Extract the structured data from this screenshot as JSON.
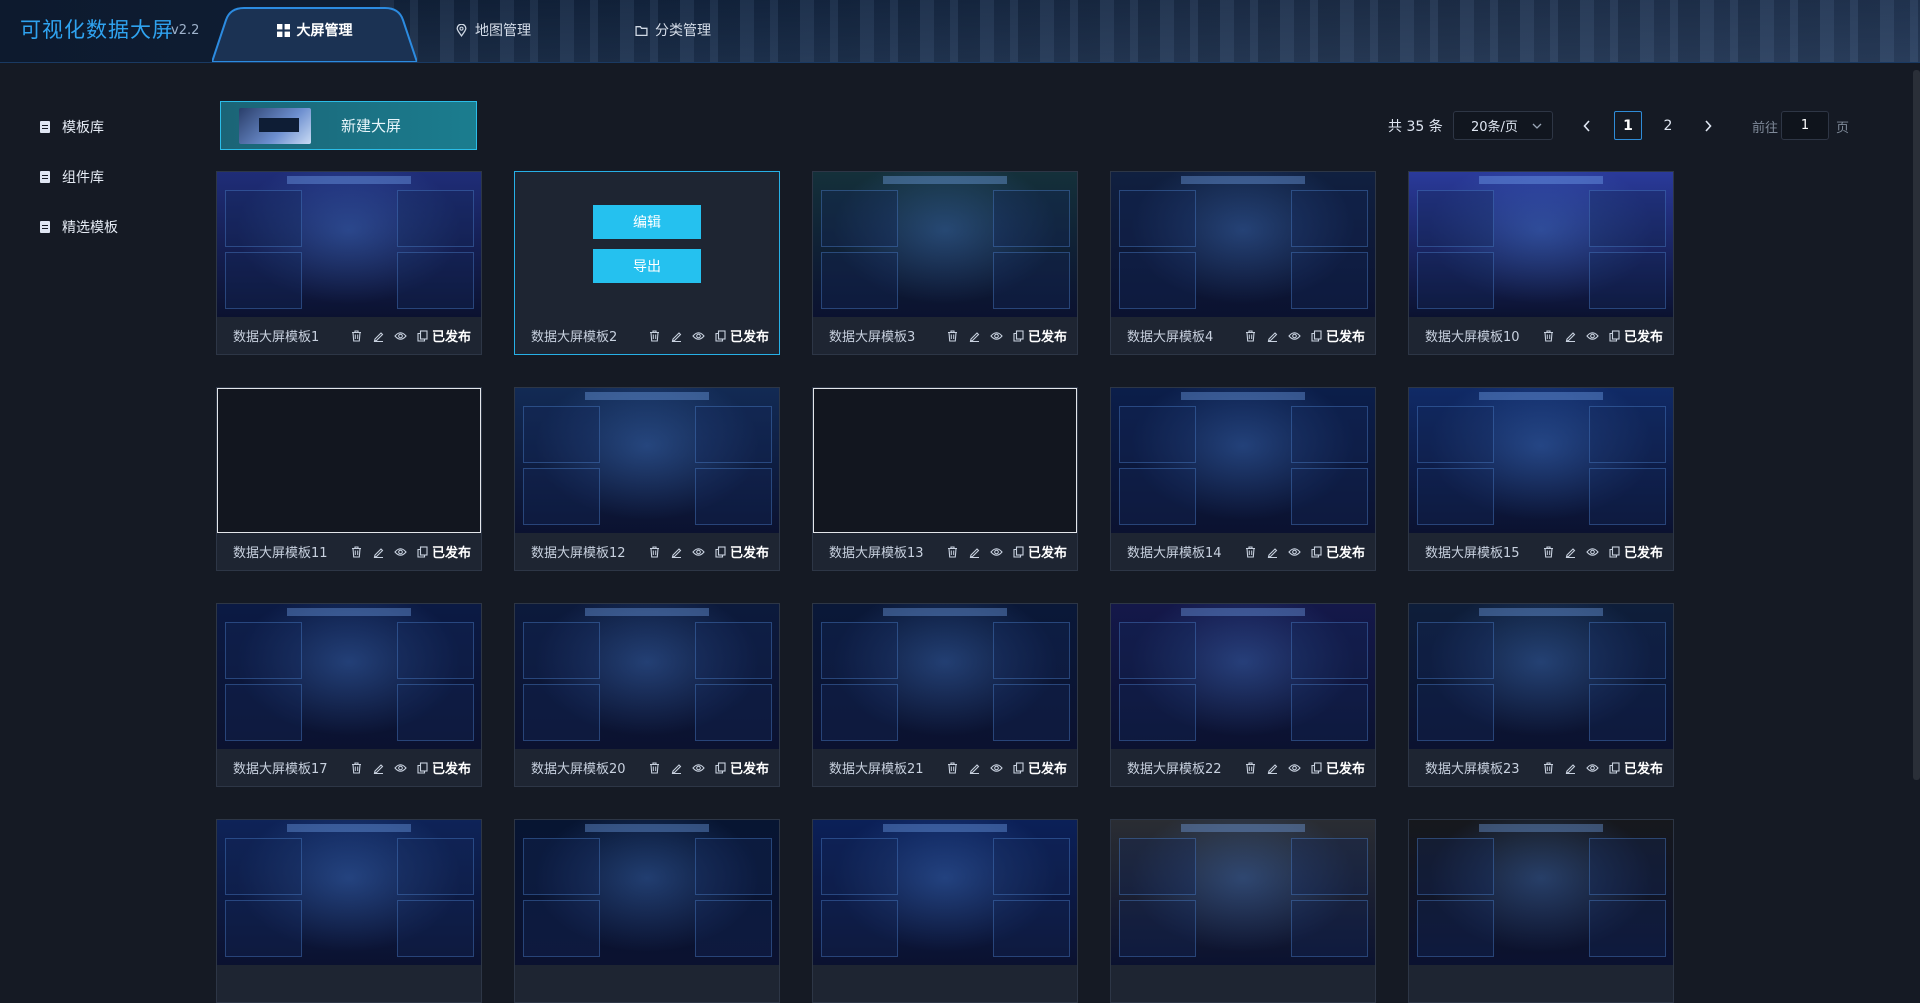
{
  "header": {
    "app_title": "可视化数据大屏",
    "version": "v2.2",
    "tabs": [
      {
        "label": "大屏管理",
        "icon": "grid-icon",
        "active": true
      },
      {
        "label": "地图管理",
        "icon": "map-pin-icon",
        "active": false
      },
      {
        "label": "分类管理",
        "icon": "folder-icon",
        "active": false
      }
    ]
  },
  "sidebar": {
    "items": [
      {
        "label": "模板库",
        "icon": "document-icon"
      },
      {
        "label": "组件库",
        "icon": "document-icon"
      },
      {
        "label": "精选模板",
        "icon": "document-icon"
      }
    ]
  },
  "toolbar": {
    "new_label": "新建大屏"
  },
  "pagination": {
    "total_text": "共 35 条",
    "page_size": "20条/页",
    "pages": [
      "1",
      "2"
    ],
    "current_page": "1",
    "goto_prefix": "前往",
    "goto_value": "1",
    "goto_suffix": "页"
  },
  "overlay": {
    "edit_label": "编辑",
    "export_label": "导出"
  },
  "cards": [
    {
      "name": "数据大屏模板1",
      "status": "已发布",
      "theme": "#1f2d78"
    },
    {
      "name": "数据大屏模板2",
      "status": "已发布",
      "theme": "#1e2532"
    },
    {
      "name": "数据大屏模板3",
      "status": "已发布",
      "theme": "#14303a"
    },
    {
      "name": "数据大屏模板4",
      "status": "已发布",
      "theme": "#102040"
    },
    {
      "name": "数据大屏模板10",
      "status": "已发布",
      "theme": "#2a3a9a"
    },
    {
      "name": "数据大屏模板11",
      "status": "已发布",
      "theme": "broken"
    },
    {
      "name": "数据大屏模板12",
      "status": "已发布",
      "theme": "#122a54"
    },
    {
      "name": "数据大屏模板13",
      "status": "已发布",
      "theme": "broken"
    },
    {
      "name": "数据大屏模板14",
      "status": "已发布",
      "theme": "#0b1e4a"
    },
    {
      "name": "数据大屏模板15",
      "status": "已发布",
      "theme": "#102a66"
    },
    {
      "name": "数据大屏模板17",
      "status": "已发布",
      "theme": "#0b1a44"
    },
    {
      "name": "数据大屏模板20",
      "status": "已发布",
      "theme": "#0c1a3c"
    },
    {
      "name": "数据大屏模板21",
      "status": "已发布",
      "theme": "#0a1838"
    },
    {
      "name": "数据大屏模板22",
      "status": "已发布",
      "theme": "#14184a"
    },
    {
      "name": "数据大屏模板23",
      "status": "已发布",
      "theme": "#0e1e3a"
    },
    {
      "name": "",
      "status": "",
      "theme": "#0e2358"
    },
    {
      "name": "",
      "status": "",
      "theme": "#071532"
    },
    {
      "name": "",
      "status": "",
      "theme": "#0b2058"
    },
    {
      "name": "",
      "status": "",
      "theme": "#2a2d33"
    },
    {
      "name": "",
      "status": "",
      "theme": "#16181d"
    }
  ],
  "card_icons": [
    "trash-icon",
    "edit-icon",
    "eye-icon",
    "copy-icon"
  ]
}
